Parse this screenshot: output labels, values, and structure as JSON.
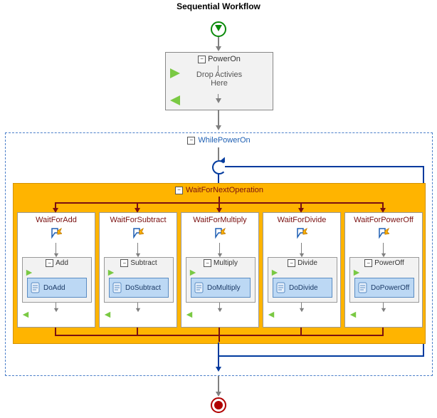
{
  "title": "Sequential Workflow",
  "powerOn": {
    "label": "PowerOn",
    "drop1": "Drop Activies",
    "drop2": "Here"
  },
  "whileLoop": {
    "label": "WhilePowerOn"
  },
  "parallel": {
    "label": "WaitForNextOperation",
    "branches": [
      {
        "label": "WaitForAdd",
        "inner": "Add",
        "code": "DoAdd"
      },
      {
        "label": "WaitForSubtract",
        "inner": "Subtract",
        "code": "DoSubtract"
      },
      {
        "label": "WaitForMultiply",
        "inner": "Multiply",
        "code": "DoMultiply"
      },
      {
        "label": "WaitForDivide",
        "inner": "Divide",
        "code": "DoDivide"
      },
      {
        "label": "WaitForPowerOff",
        "inner": "PowerOff",
        "code": "DoPowerOff"
      }
    ]
  }
}
